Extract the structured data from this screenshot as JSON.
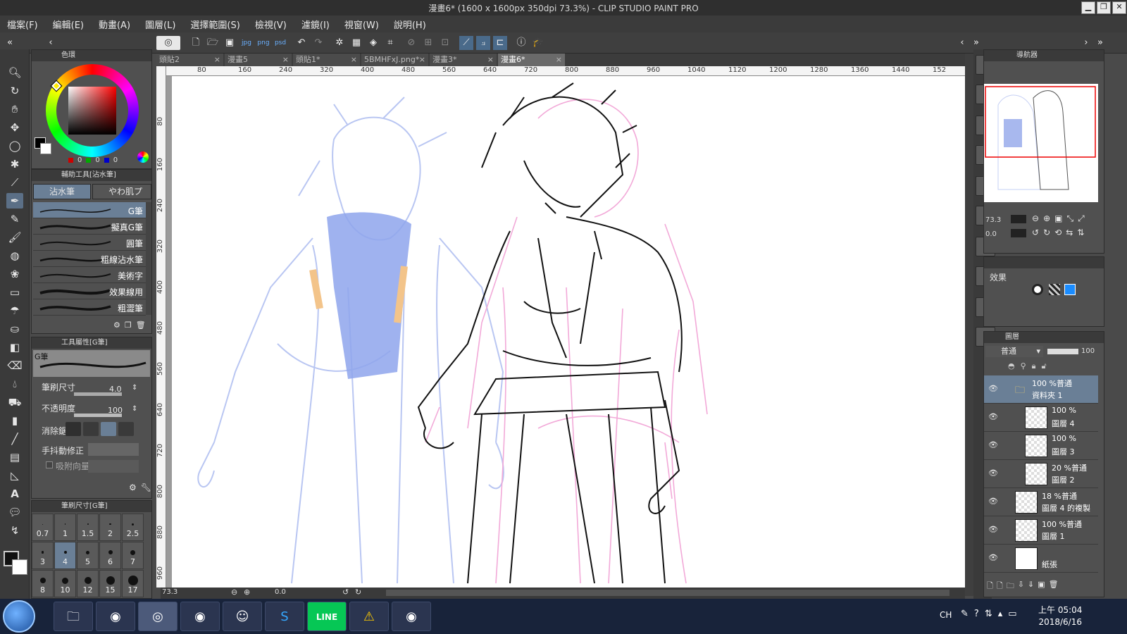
{
  "window": {
    "title": "漫畫6* (1600 x 1600px 350dpi 73.3%) - CLIP STUDIO PAINT PRO"
  },
  "menu": [
    "檔案(F)",
    "編輯(E)",
    "動畫(A)",
    "圖層(L)",
    "選擇範圍(S)",
    "檢視(V)",
    "濾鏡(I)",
    "視窗(W)",
    "說明(H)"
  ],
  "tabs": [
    {
      "label": "頭貼2"
    },
    {
      "label": "漫畫5"
    },
    {
      "label": "頭貼1*"
    },
    {
      "label": "5BMHFxJ.png*"
    },
    {
      "label": "漫畫3*"
    },
    {
      "label": "漫畫6*"
    }
  ],
  "color_panel": {
    "title": "色環",
    "r": "0",
    "g": "0",
    "b": "0"
  },
  "subtool_panel": {
    "title": "輔助工具[沾水筆]",
    "group_tabs": [
      "沾水筆",
      "やわ肌プ"
    ],
    "brushes": [
      "G筆",
      "擬真G筆",
      "圓筆",
      "粗線沾水筆",
      "美術字",
      "效果線用",
      "粗澀筆"
    ]
  },
  "toolprop_panel": {
    "title": "工具屬性[G筆]",
    "preview_name": "G筆",
    "brush_size_label": "筆刷尺寸",
    "brush_size_value": "4.0",
    "opacity_label": "不透明度",
    "opacity_value": "100",
    "aa_label": "消除鋸齒",
    "stabilizer_label": "手抖動修正",
    "vector_label": "吸附向量"
  },
  "brushsize_panel": {
    "title": "筆刷尺寸[G筆]",
    "sizes": [
      "0.7",
      "1",
      "1.5",
      "2",
      "2.5",
      "3",
      "4",
      "5",
      "6",
      "7",
      "8",
      "10",
      "12",
      "15",
      "17"
    ],
    "selected": "4"
  },
  "ruler_h": [
    "80",
    "160",
    "240",
    "320",
    "400",
    "480",
    "560",
    "640",
    "720",
    "800",
    "880",
    "960",
    "1040",
    "1120",
    "1200",
    "1280",
    "1360",
    "1440",
    "152"
  ],
  "ruler_v": [
    "80",
    "160",
    "240",
    "320",
    "400",
    "480",
    "560",
    "640",
    "720",
    "800",
    "880",
    "960"
  ],
  "status": {
    "zoom": "73.3",
    "rotation": "0.0"
  },
  "navigator": {
    "title": "導航器",
    "zoom": "73.3",
    "rotation": "0.0"
  },
  "effect_panel": {
    "label": "效果"
  },
  "layer_panel": {
    "title": "圖層",
    "blend_mode": "普通",
    "opacity": "100",
    "layers": [
      {
        "name": "資料夾 1",
        "mode": "100 %普通",
        "indent": 0,
        "folder": true
      },
      {
        "name": "圖層 4",
        "mode": "100 %",
        "indent": 1
      },
      {
        "name": "圖層 3",
        "mode": "100 %",
        "indent": 1
      },
      {
        "name": "圖層 2",
        "mode": "20 %普通",
        "indent": 1
      },
      {
        "name": "圖層 4 的複製",
        "mode": "18 %普通",
        "indent": 0
      },
      {
        "name": "圖層 1",
        "mode": "100 %普通",
        "indent": 0
      },
      {
        "name": "紙張",
        "mode": "",
        "indent": 0
      }
    ]
  },
  "taskbar": {
    "lang": "CH",
    "time": "上午 05:04",
    "date": "2018/6/16"
  }
}
